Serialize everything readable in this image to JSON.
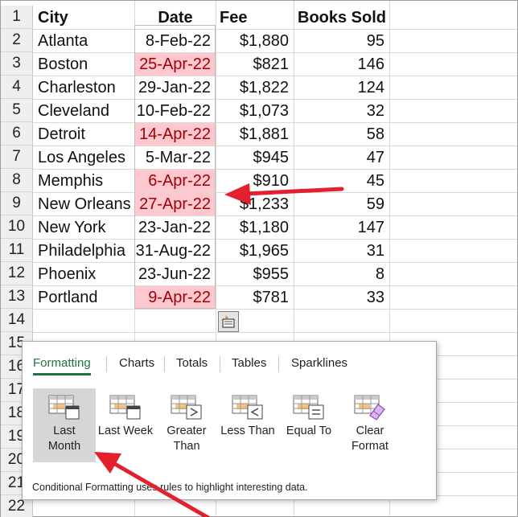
{
  "sheet": {
    "row_numbers": [
      "1",
      "2",
      "3",
      "4",
      "5",
      "6",
      "7",
      "8",
      "9",
      "10",
      "11",
      "12",
      "13",
      "14",
      "15",
      "16",
      "17",
      "18",
      "19",
      "20",
      "21",
      "22"
    ],
    "headers": {
      "city": "City",
      "date": "Date",
      "fee": "Fee",
      "books": "Books Sold"
    },
    "rows": [
      {
        "city": "Atlanta",
        "date": "8-Feb-22",
        "fee": "$1,880",
        "books": "95",
        "last_month": false
      },
      {
        "city": "Boston",
        "date": "25-Apr-22",
        "fee": "$821",
        "books": "146",
        "last_month": true
      },
      {
        "city": "Charleston",
        "date": "29-Jan-22",
        "fee": "$1,822",
        "books": "124",
        "last_month": false
      },
      {
        "city": "Cleveland",
        "date": "10-Feb-22",
        "fee": "$1,073",
        "books": "32",
        "last_month": false
      },
      {
        "city": "Detroit",
        "date": "14-Apr-22",
        "fee": "$1,881",
        "books": "58",
        "last_month": true
      },
      {
        "city": "Los Angeles",
        "date": "5-Mar-22",
        "fee": "$945",
        "books": "47",
        "last_month": false
      },
      {
        "city": "Memphis",
        "date": "6-Apr-22",
        "fee": "$910",
        "books": "45",
        "last_month": true
      },
      {
        "city": "New Orleans",
        "date": "27-Apr-22",
        "fee": "$1,233",
        "books": "59",
        "last_month": true
      },
      {
        "city": "New York",
        "date": "23-Jan-22",
        "fee": "$1,180",
        "books": "147",
        "last_month": false
      },
      {
        "city": "Philadelphia",
        "date": "31-Aug-22",
        "fee": "$1,965",
        "books": "31",
        "last_month": false
      },
      {
        "city": "Phoenix",
        "date": "23-Jun-22",
        "fee": "$955",
        "books": "8",
        "last_month": false
      },
      {
        "city": "Portland",
        "date": "9-Apr-22",
        "fee": "$781",
        "books": "33",
        "last_month": true
      }
    ]
  },
  "quick_analysis": {
    "tabs": [
      "Formatting",
      "Charts",
      "Totals",
      "Tables",
      "Sparklines"
    ],
    "active_tab": "Formatting",
    "tools": [
      {
        "label": "Last\nMonth",
        "icon": "last-month-icon",
        "active": true
      },
      {
        "label": "Last Week",
        "icon": "last-week-icon",
        "active": false
      },
      {
        "label": "Greater\nThan",
        "icon": "greater-than-icon",
        "active": false
      },
      {
        "label": "Less Than",
        "icon": "less-than-icon",
        "active": false
      },
      {
        "label": "Equal To",
        "icon": "equal-to-icon",
        "active": false
      },
      {
        "label": "Clear\nFormat",
        "icon": "clear-format-icon",
        "active": false
      }
    ],
    "description": "Conditional Formatting uses rules to highlight interesting data."
  },
  "colors": {
    "highlight_fill": "#ffc7ce",
    "highlight_text": "#9c0006",
    "accent": "#217346",
    "annotation_arrow": "#e3202e"
  }
}
